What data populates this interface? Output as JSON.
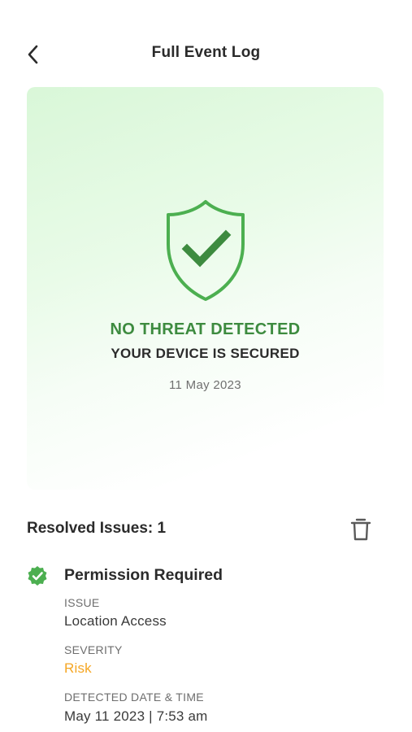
{
  "header": {
    "title": "Full Event Log",
    "back_icon": "chevron-left-icon"
  },
  "status_card": {
    "icon": "shield-check-icon",
    "title": "NO THREAT DETECTED",
    "subtitle": "YOUR DEVICE IS SECURED",
    "date": "11 May 2023",
    "accent_color": "#3d8b3f",
    "shield_color": "#4caf50"
  },
  "resolved": {
    "label": "Resolved Issues: 1",
    "delete_icon": "trash-icon"
  },
  "issue": {
    "status_icon": "verified-check-icon",
    "title": "Permission Required",
    "issue_label": "ISSUE",
    "issue_value": "Location Access",
    "severity_label": "SEVERITY",
    "severity_value": "Risk",
    "severity_color": "#f5a623",
    "detected_label": "DETECTED DATE & TIME",
    "detected_value": "May 11 2023 | 7:53 am"
  }
}
